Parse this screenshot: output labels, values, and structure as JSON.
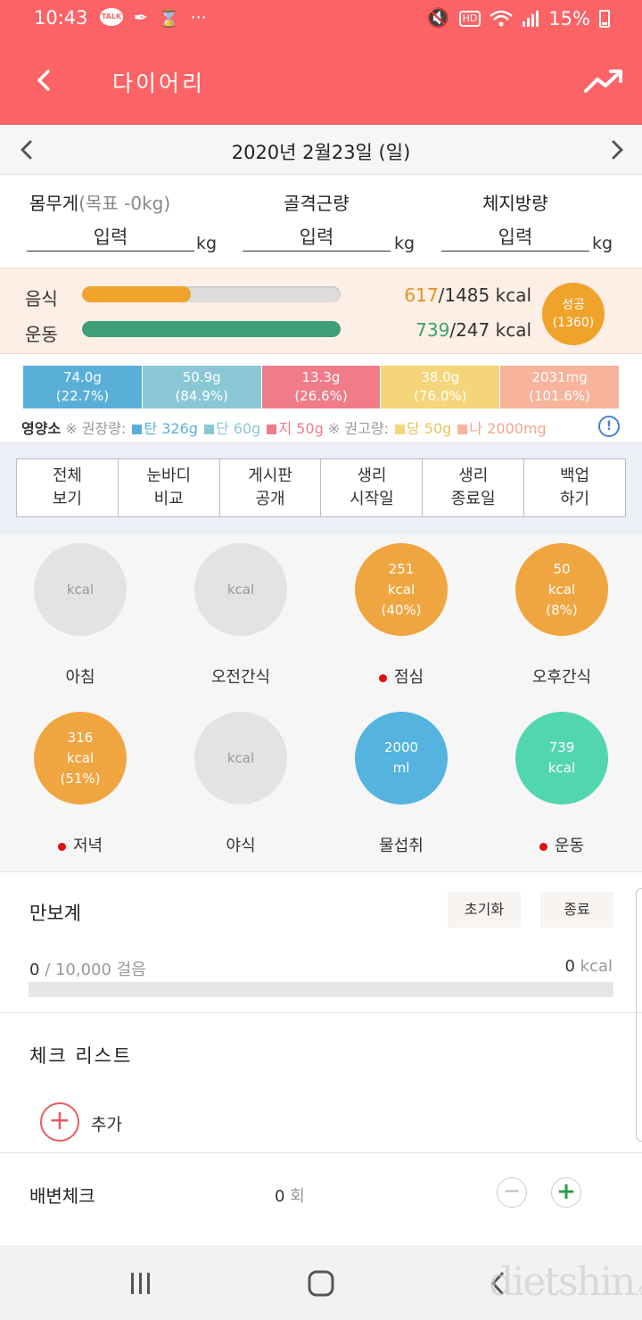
{
  "status_bar": {
    "time": "10:43",
    "talk": "TALK",
    "more": "···",
    "hd": "HD",
    "battery": "15%"
  },
  "app_bar": {
    "title": "다이어리",
    "back_icon": "chevron-left-icon",
    "trend_icon": "trending-up-icon"
  },
  "date_bar": {
    "date": "2020년 2월23일 (일)"
  },
  "measurements": {
    "weight_label": "몸무게",
    "weight_goal": "(목표 -0kg)",
    "muscle_label": "골격근량",
    "fat_label": "체지방량",
    "input_placeholder": "입력",
    "unit": "kg"
  },
  "calories": {
    "food_label": "음식",
    "food_value": "617",
    "food_target": "/1485",
    "food_unit": "kcal",
    "food_fraction": 0.42,
    "exercise_label": "운동",
    "exercise_value": "739",
    "exercise_target": "/247",
    "exercise_unit": "kcal",
    "exercise_fraction": 1.0,
    "success_label": "성공",
    "success_value": "(1360)",
    "colors": {
      "food": "#f0a32b",
      "exercise": "#3d9e78",
      "food_value": "#e2941a",
      "exercise_value": "#3aa36f"
    }
  },
  "nutrition": {
    "boxes": [
      {
        "amount": "74.0g",
        "percent": "(22.7%)",
        "color": "#5aafd9"
      },
      {
        "amount": "50.9g",
        "percent": "(84.9%)",
        "color": "#8ac7d6"
      },
      {
        "amount": "13.3g",
        "percent": "(26.6%)",
        "color": "#f07c8a"
      },
      {
        "amount": "38.0g",
        "percent": "(76.0%)",
        "color": "#f5d57a"
      },
      {
        "amount": "2031mg",
        "percent": "(101.6%)",
        "color": "#f7b39c"
      }
    ],
    "legend_title": "영양소",
    "recommended_label": "※ 권장량:",
    "limit_label": "※ 권고량:",
    "carb": "탄 326g",
    "protein": "단 60g",
    "fat": "지 50g",
    "sugar": "당 50g",
    "sodium": "나 2000mg",
    "info": "!"
  },
  "actions": [
    {
      "line1": "전체",
      "line2": "보기"
    },
    {
      "line1": "눈바디",
      "line2": "비교"
    },
    {
      "line1": "게시판",
      "line2": "공개"
    },
    {
      "line1": "생리",
      "line2": "시작일"
    },
    {
      "line1": "생리",
      "line2": "종료일"
    },
    {
      "line1": "백업",
      "line2": "하기"
    }
  ],
  "meals": [
    {
      "label": "아침",
      "l1": "kcal",
      "l2": "",
      "l3": "",
      "marked": false,
      "color": "#e3e3e3"
    },
    {
      "label": "오전간식",
      "l1": "kcal",
      "l2": "",
      "l3": "",
      "marked": false,
      "color": "#e3e3e3"
    },
    {
      "label": "점심",
      "l1": "251",
      "l2": "kcal",
      "l3": "(40%)",
      "marked": true,
      "color": "#efa640"
    },
    {
      "label": "오후간식",
      "l1": "50",
      "l2": "kcal",
      "l3": "(8%)",
      "marked": false,
      "color": "#efa640"
    },
    {
      "label": "저녁",
      "l1": "316",
      "l2": "kcal",
      "l3": "(51%)",
      "marked": true,
      "color": "#efa640"
    },
    {
      "label": "야식",
      "l1": "kcal",
      "l2": "",
      "l3": "",
      "marked": false,
      "color": "#e3e3e3"
    },
    {
      "label": "물섭취",
      "l1": "2000",
      "l2": "ml",
      "l3": "",
      "marked": false,
      "color": "#54b3df"
    },
    {
      "label": "운동",
      "l1": "739",
      "l2": "kcal",
      "l3": "",
      "marked": true,
      "color": "#52d6b0"
    }
  ],
  "pedometer": {
    "title": "만보계",
    "reset_label": "초기화",
    "stop_label": "종료",
    "steps": "0",
    "steps_goal": "/ 10,000 걸음",
    "kcal_value": "0",
    "kcal_unit": "kcal",
    "progress": 0
  },
  "checklist": {
    "title": "체크 리스트",
    "add_label": "추가"
  },
  "bowel": {
    "title": "배변체크",
    "count": "0",
    "unit": "회"
  },
  "watermark": {
    "brand": "dietshin",
    "suffix": ".com"
  }
}
